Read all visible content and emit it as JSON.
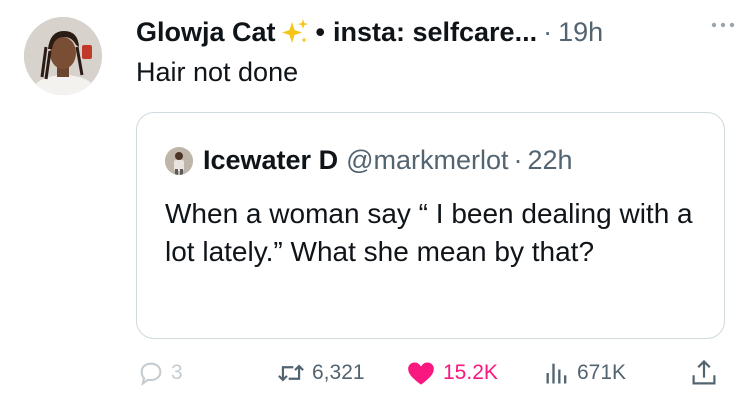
{
  "post": {
    "author_name": "Glowja Cat",
    "bio_snippet": "insta: selfcare...",
    "separator": "·",
    "time": "19h",
    "text": "Hair not done"
  },
  "quoted": {
    "name": "Icewater D",
    "handle": "@markmerlot",
    "separator": "·",
    "time": "22h",
    "text": "When a woman say “ I been dealing with a lot lately.” What she mean by that?"
  },
  "actions": {
    "replies": "3",
    "reposts": "6,321",
    "likes": "15.2K",
    "views": "671K"
  },
  "colors": {
    "like": "#f91880",
    "secondary_text": "#536471",
    "border": "#cfd9de"
  },
  "icons": [
    "sparkle-icon",
    "more-icon",
    "reply-icon",
    "repost-icon",
    "heart-icon",
    "views-icon",
    "share-icon"
  ]
}
